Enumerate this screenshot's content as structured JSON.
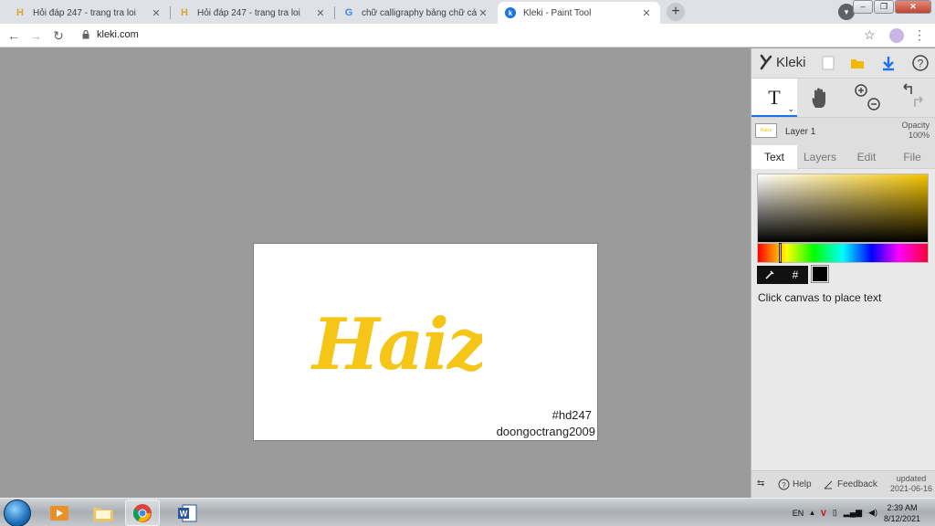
{
  "browser": {
    "tabs": [
      {
        "title": "Hỏi đáp 247 - trang tra loi",
        "favicon": "h-icon",
        "active": false
      },
      {
        "title": "Hỏi đáp 247 - trang tra loi",
        "favicon": "h-icon",
        "active": false
      },
      {
        "title": "chữ calligraphy bảng chữ cái - G",
        "favicon": "google-icon",
        "active": false
      },
      {
        "title": "Kleki - Paint Tool",
        "favicon": "kleki-icon",
        "active": true
      }
    ],
    "url": "kleki.com"
  },
  "canvas": {
    "art_text": "Haizz",
    "art_color": "#f5c518",
    "caption_line1": "#hd247",
    "caption_line2": "doongoctrang2009"
  },
  "panel": {
    "logo": "Kleki",
    "layer_name": "Layer 1",
    "opacity_label": "Opacity",
    "opacity_value": "100%",
    "tabs": [
      "Text",
      "Layers",
      "Edit",
      "File"
    ],
    "active_tab": "Text",
    "selected_color": "#000000",
    "hex_button": "#",
    "hint": "Click canvas to place text",
    "bottom": {
      "help": "Help",
      "feedback": "Feedback",
      "updated_label": "updated",
      "updated_date": "2021-06-16"
    }
  },
  "taskbar": {
    "language": "EN",
    "time": "2:39 AM",
    "date": "8/12/2021"
  }
}
